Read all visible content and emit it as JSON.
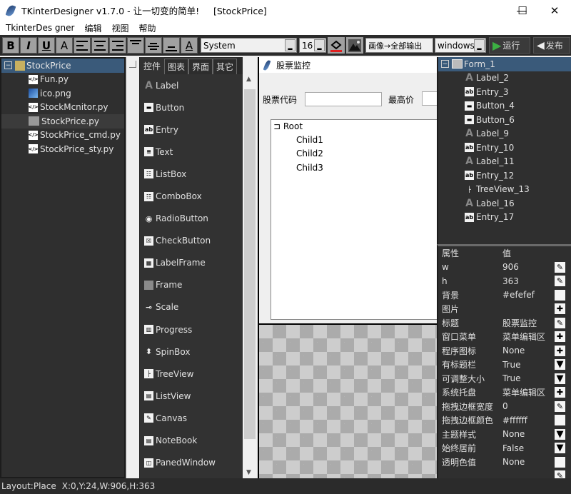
{
  "window": {
    "title": "TKinterDesigner v1.7.0 - 让一切变的简单!     [StockPrice]",
    "minimize_icon": "—",
    "maximize_icon": "☐",
    "close_icon": "✕"
  },
  "menu": [
    "TkinterDes gner",
    "编辑",
    "视图",
    "帮助"
  ],
  "toolbar": {
    "bold": "B",
    "italic": "I",
    "underline": "U",
    "font_color": "A",
    "text_color": "A",
    "font_family": "System",
    "font_size": "16",
    "image_mode": "画像→全部输出",
    "platform": "windows",
    "run_label": "运行",
    "publish_label": "发布",
    "accent_run": "#3cb043"
  },
  "project_tree": {
    "root": "StockPrice",
    "files": [
      {
        "name": "Fun.py",
        "icon": "code-file-icon"
      },
      {
        "name": "ico.png",
        "icon": "image-file-icon"
      },
      {
        "name": "StockMcnitor.py",
        "icon": "code-file-icon"
      },
      {
        "name": "StockPrice.py",
        "icon": "form-file-icon",
        "selected": true
      },
      {
        "name": "StockPrice_cmd.py",
        "icon": "code-file-icon"
      },
      {
        "name": "StockPrice_sty.py",
        "icon": "code-file-icon"
      }
    ]
  },
  "widget_tabs": [
    "控件",
    "图表",
    "界面",
    "其它"
  ],
  "widgets": [
    "Label",
    "Button",
    "Entry",
    "Text",
    "ListBox",
    "ComboBox",
    "RadioButton",
    "CheckButton",
    "LabelFrame",
    "Frame",
    "Scale",
    "Progress",
    "SpinBox",
    "TreeView",
    "ListView",
    "Canvas",
    "NoteBook",
    "PanedWindow"
  ],
  "form": {
    "title": "股票监控",
    "label_code": "股票代码",
    "label_high": "最高价",
    "tree_root": "Root",
    "tree_children": [
      "Child1",
      "Child2",
      "Child3"
    ]
  },
  "object_tree": {
    "root": "Form_1",
    "items": [
      "Label_2",
      "Entry_3",
      "Button_4",
      "Button_6",
      "Label_9",
      "Entry_10",
      "Label_11",
      "Entry_12",
      "TreeView_13",
      "Label_16",
      "Entry_17"
    ]
  },
  "properties": {
    "header_key": "属性",
    "header_value": "值",
    "rows": [
      {
        "key": "w",
        "value": "906",
        "btn": "✎"
      },
      {
        "key": "h",
        "value": "363",
        "btn": "✎"
      },
      {
        "key": "背景",
        "value": "#efefef",
        "btn": ""
      },
      {
        "key": "图片",
        "value": "",
        "btn": "✚"
      },
      {
        "key": "标题",
        "value": "股票监控",
        "btn": "✎"
      },
      {
        "key": "窗口菜单",
        "value": "菜单编辑区",
        "btn": "✚"
      },
      {
        "key": "程序图标",
        "value": "None",
        "btn": "✚"
      },
      {
        "key": "有标题栏",
        "value": "True",
        "btn": "▼"
      },
      {
        "key": "可调整大小",
        "value": "True",
        "btn": "▼"
      },
      {
        "key": "系统托盘",
        "value": "菜单编辑区",
        "btn": "✚"
      },
      {
        "key": "拖拽边框宽度",
        "value": "0",
        "btn": "✎"
      },
      {
        "key": "拖拽边框颜色",
        "value": "#ffffff",
        "btn": ""
      },
      {
        "key": "主题样式",
        "value": "None",
        "btn": "▼"
      },
      {
        "key": "始终居前",
        "value": "False",
        "btn": "▼"
      },
      {
        "key": "透明色值",
        "value": "None",
        "btn": ""
      },
      {
        "key": "",
        "value": "",
        "btn": "✎"
      }
    ]
  },
  "status": {
    "layout": "Layout:Place",
    "geometry": "X:0,Y:24,W:906,H:363"
  }
}
